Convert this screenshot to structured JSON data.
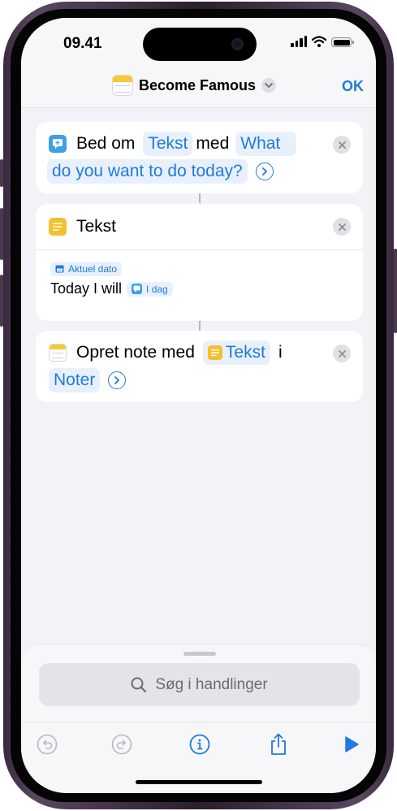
{
  "status_bar": {
    "time": "09.41"
  },
  "nav": {
    "title": "Become Famous",
    "ok_label": "OK"
  },
  "cards": {
    "ask": {
      "action": "Bed om",
      "type_token": "Tekst",
      "with": "med",
      "prompt_part1": "What",
      "prompt_part2": "do you want to do today?"
    },
    "text": {
      "title": "Tekst",
      "date_token": "Aktuel dato",
      "body": "Today I will",
      "var_token": "I dag"
    },
    "note": {
      "action": "Opret note med",
      "text_token": "Tekst",
      "in": "i",
      "app_token": "Noter"
    }
  },
  "sheet": {
    "search_placeholder": "Søg i handlinger"
  },
  "toolbar": {
    "icons": [
      "undo-icon",
      "redo-icon",
      "info-icon",
      "share-icon",
      "play-icon"
    ]
  },
  "colors": {
    "accent": "#1f7ae0",
    "token_bg": "#e8f1fb",
    "background": "#f2f2f7"
  }
}
